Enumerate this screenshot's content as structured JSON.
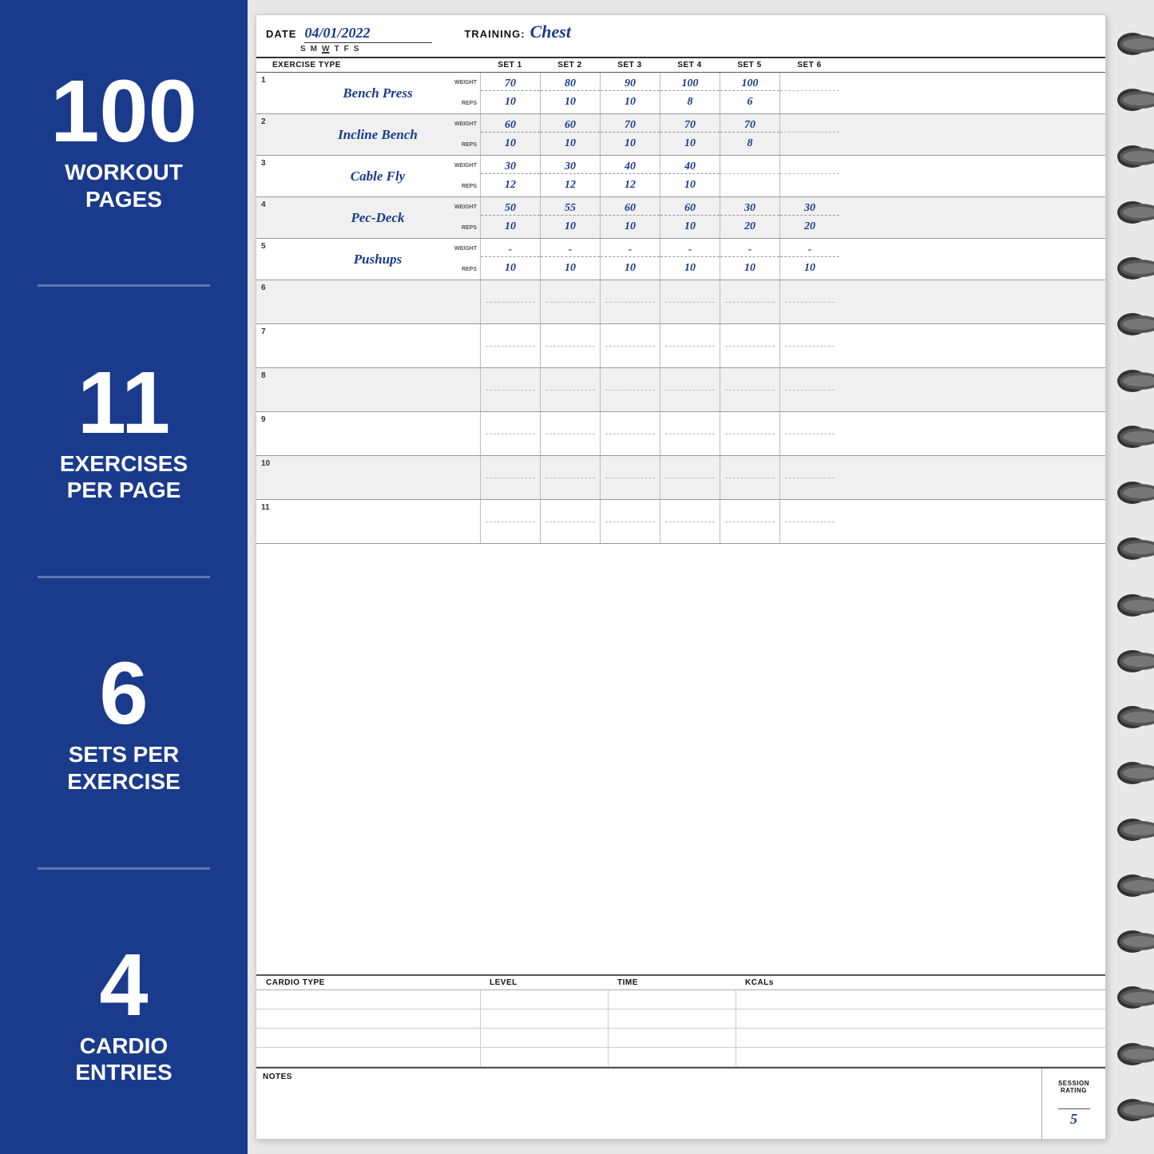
{
  "left_panel": {
    "stats": [
      {
        "number": "100",
        "label": "WORKOUT\nPAGES"
      },
      {
        "number": "11",
        "label": "EXERCISES\nPER PAGE"
      },
      {
        "number": "6",
        "label": "SETS PER\nEXERCISE"
      },
      {
        "number": "4",
        "label": "CARDIO\nENTRIES"
      }
    ]
  },
  "notebook": {
    "date_label": "DATE",
    "date_value": "04/01/2022",
    "training_label": "TRAINING:",
    "training_value": "Chest",
    "days": [
      "S",
      "M",
      "W",
      "T",
      "F",
      "S"
    ],
    "underlined_day": "W",
    "columns": {
      "exercise": "EXERCISE TYPE",
      "sets": [
        "SET 1",
        "SET 2",
        "SET 3",
        "SET 4",
        "SET 5",
        "SET 6"
      ]
    },
    "exercises": [
      {
        "number": "1",
        "name": "Bench Press",
        "weights": [
          "70",
          "80",
          "90",
          "100",
          "100",
          ""
        ],
        "reps": [
          "10",
          "10",
          "10",
          "8",
          "6",
          ""
        ]
      },
      {
        "number": "2",
        "name": "Incline Bench",
        "weights": [
          "60",
          "60",
          "70",
          "70",
          "70",
          ""
        ],
        "reps": [
          "10",
          "10",
          "10",
          "10",
          "8",
          ""
        ]
      },
      {
        "number": "3",
        "name": "Cable Fly",
        "weights": [
          "30",
          "30",
          "40",
          "40",
          "",
          ""
        ],
        "reps": [
          "12",
          "12",
          "12",
          "10",
          "",
          ""
        ]
      },
      {
        "number": "4",
        "name": "Pec-Deck",
        "weights": [
          "50",
          "55",
          "60",
          "60",
          "30",
          "30"
        ],
        "reps": [
          "10",
          "10",
          "10",
          "10",
          "20",
          "20"
        ]
      },
      {
        "number": "5",
        "name": "Pushups",
        "weights": [
          "-",
          "-",
          "-",
          "-",
          "-",
          "-"
        ],
        "reps": [
          "10",
          "10",
          "10",
          "10",
          "10",
          "10"
        ]
      },
      {
        "number": "6",
        "name": "",
        "weights": [
          "",
          "",
          "",
          "",
          "",
          ""
        ],
        "reps": [
          "",
          "",
          "",
          "",
          "",
          ""
        ]
      },
      {
        "number": "7",
        "name": "",
        "weights": [
          "",
          "",
          "",
          "",
          "",
          ""
        ],
        "reps": [
          "",
          "",
          "",
          "",
          "",
          ""
        ]
      },
      {
        "number": "8",
        "name": "",
        "weights": [
          "",
          "",
          "",
          "",
          "",
          ""
        ],
        "reps": [
          "",
          "",
          "",
          "",
          "",
          ""
        ]
      },
      {
        "number": "9",
        "name": "",
        "weights": [
          "",
          "",
          "",
          "",
          "",
          ""
        ],
        "reps": [
          "",
          "",
          "",
          "",
          "",
          ""
        ]
      },
      {
        "number": "10",
        "name": "",
        "weights": [
          "",
          "",
          "",
          "",
          "",
          ""
        ],
        "reps": [
          "",
          "",
          "",
          "",
          "",
          ""
        ]
      },
      {
        "number": "11",
        "name": "",
        "weights": [
          "",
          "",
          "",
          "",
          "",
          ""
        ],
        "reps": [
          "",
          "",
          "",
          "",
          "",
          ""
        ]
      }
    ],
    "cardio": {
      "headers": [
        "CARDIO TYPE",
        "LEVEL",
        "TIME",
        "KCALs"
      ],
      "rows": 4
    },
    "notes": {
      "label": "NOTES",
      "session_label": "SESSION\nRATING",
      "rating": "5"
    }
  }
}
